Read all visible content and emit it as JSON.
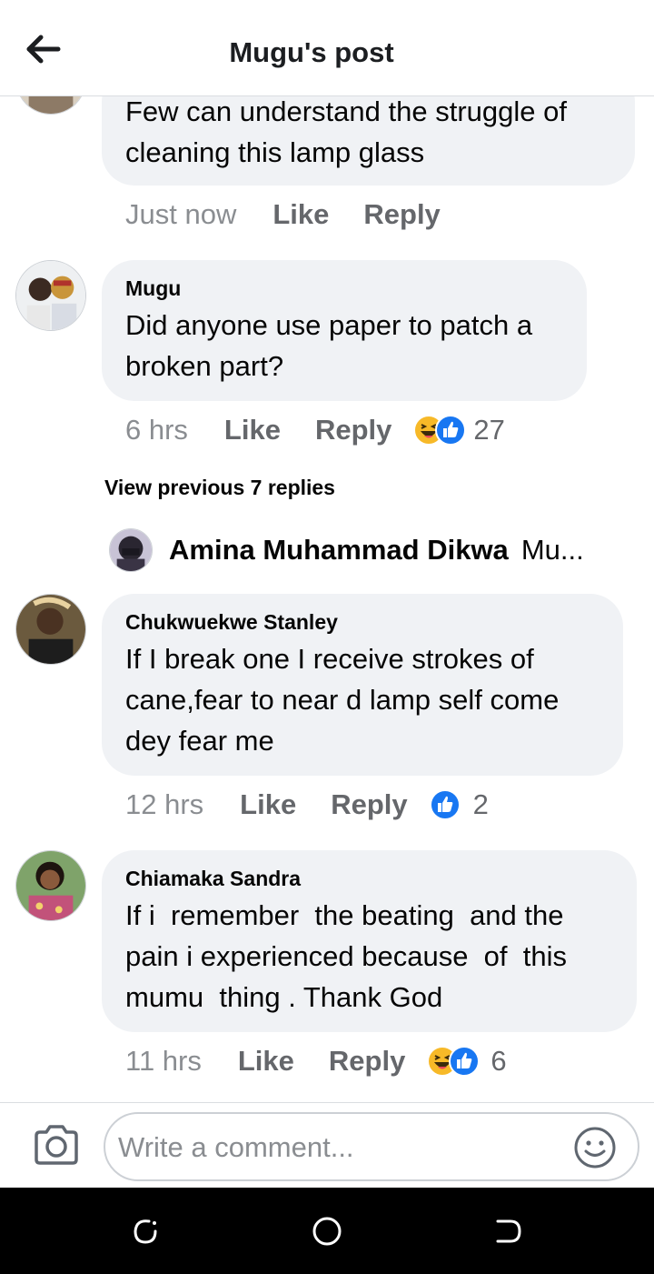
{
  "header": {
    "title": "Mugu's post"
  },
  "comments": [
    {
      "author": "",
      "text": "Few can understand the struggle of cleaning this lamp glass",
      "time": "Just now",
      "like": "Like",
      "reply": "Reply",
      "reactions": null
    },
    {
      "author": "Mugu",
      "text": "Did anyone use paper to patch a broken part?",
      "time": "6 hrs",
      "like": "Like",
      "reply": "Reply",
      "reactions": {
        "icons": [
          "haha-icon",
          "like-icon"
        ],
        "count": "27"
      }
    },
    {
      "author": "Chukwuekwe Stanley",
      "text": "If I break one I receive strokes of cane,fear to near d lamp self come dey fear me",
      "time": "12 hrs",
      "like": "Like",
      "reply": "Reply",
      "reactions": {
        "icons": [
          "like-icon"
        ],
        "count": "2"
      }
    },
    {
      "author": "Chiamaka Sandra",
      "text": "If i  remember  the beating  and the pain i experienced because  of  this mumu  thing . Thank God",
      "time": "11 hrs",
      "like": "Like",
      "reply": "Reply",
      "reactions": {
        "icons": [
          "haha-icon",
          "like-icon"
        ],
        "count": "6"
      }
    }
  ],
  "replies_thread": {
    "view_previous": "View previous 7 replies",
    "preview_name": "Amina Muhammad Dikwa",
    "preview_snippet": "Mu..."
  },
  "composer": {
    "placeholder": "Write a comment..."
  },
  "colors": {
    "bubble": "#f0f2f5",
    "meta": "#65676b",
    "like_blue": "#1877f2",
    "haha_yellow": "#f7b928"
  }
}
